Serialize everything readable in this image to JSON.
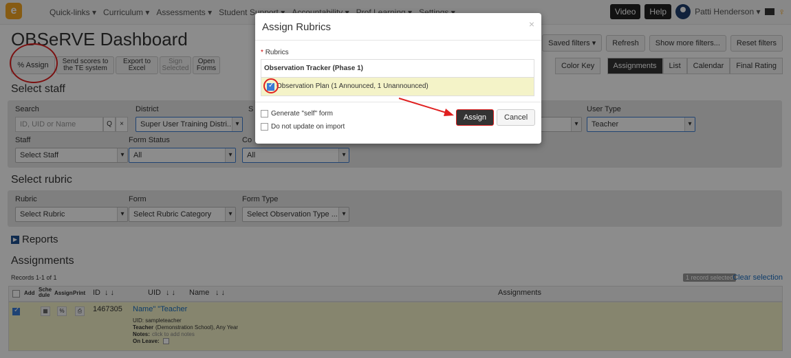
{
  "navbar": {
    "logo": "e",
    "items": [
      "Quick-links ▾",
      "Curriculum ▾",
      "Assessments ▾",
      "Student Support ▾",
      "Accountability ▾",
      "Prof Learning ▾",
      "Settings ▾"
    ],
    "video": "Video",
    "help": "Help",
    "user": "Patti Henderson ▾"
  },
  "page_title": "OBSeRVE Dashboard",
  "toolbar": {
    "assign": "% Assign",
    "send_scores": "Send scores to the TE system",
    "export": "Export to Excel",
    "sign": "Sign Selected",
    "open_forms": "Open Forms"
  },
  "right_tools": {
    "saved_filters": "Saved filters ▾",
    "refresh": "Refresh",
    "show_more": "Show more filters...",
    "reset": "Reset filters",
    "color_key": "Color Key"
  },
  "view_tabs": [
    "Assignments",
    "List",
    "Calendar",
    "Final Rating"
  ],
  "select_staff": {
    "title": "Select staff",
    "search_label": "Search",
    "search_placeholder": "ID, UID or Name",
    "district_label": "District",
    "district_value": "Super User Training Distri...",
    "user_type_label": "User Type",
    "user_type_value": "Teacher",
    "staff_label": "Staff",
    "staff_value": "Select Staff",
    "form_status_label": "Form Status",
    "form_status_value": "All",
    "comp_label": "Co",
    "comp_value": "All",
    "s_label": "S"
  },
  "select_rubric": {
    "title": "Select rubric",
    "rubric_label": "Rubric",
    "rubric_value": "Select Rubric",
    "form_label": "Form",
    "form_value": "Select Rubric Category",
    "form_type_label": "Form Type",
    "form_type_value": "Select Observation Type ..."
  },
  "reports": "Reports",
  "assignments": {
    "title": "Assignments",
    "records": "Records 1-1 of 1",
    "selected_badge": "1 record selected",
    "clear": "Clear selection",
    "headers": {
      "add": "Add",
      "schedule": "Sche dule",
      "assign": "Assign",
      "print": "Print",
      "id": "ID",
      "uid": "UID",
      "name": "Name",
      "assignments": "Assignments"
    },
    "row": {
      "id": "1467305",
      "name": "Name\" \"Teacher",
      "uid": "UID: sampleteacher",
      "teacher": "Teacher",
      "school": "(Demonstration School), Any Year",
      "notes_label": "Notes:",
      "notes_link": "click to add notes",
      "on_leave": "On Leave:"
    }
  },
  "modal": {
    "title": "Assign Rubrics",
    "close": "×",
    "rubrics_label": "Rubrics",
    "required": "*",
    "group_title": "Observation Tracker (Phase 1)",
    "item_label": "Observation Plan (1 Announced, 1 Unannounced)",
    "opt_self": "Generate \"self\" form",
    "opt_no_update": "Do not update on import",
    "assign": "Assign",
    "cancel": "Cancel"
  }
}
